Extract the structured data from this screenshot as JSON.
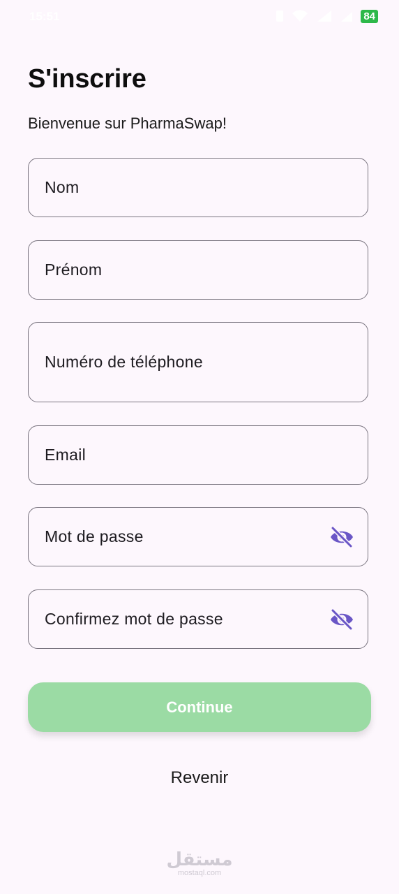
{
  "status_bar": {
    "time": "15:51",
    "battery": "84"
  },
  "header": {
    "title": "S'inscrire",
    "subtitle": "Bienvenue sur PharmaSwap!"
  },
  "form": {
    "last_name_placeholder": "Nom",
    "first_name_placeholder": "Prénom",
    "phone_placeholder": "Numéro de téléphone",
    "email_placeholder": "Email",
    "password_placeholder": "Mot de passe",
    "confirm_password_placeholder": "Confirmez mot de passe"
  },
  "actions": {
    "continue_label": "Continue",
    "back_label": "Revenir"
  },
  "watermark": {
    "logo": "مستقل",
    "url": "mostaql.com"
  },
  "colors": {
    "background": "#fdf7fd",
    "button_green": "#9bdba4",
    "icon_purple": "#6a56c6",
    "border": "#7a7580"
  },
  "icons": {
    "password_toggle": "eye-off-icon"
  }
}
